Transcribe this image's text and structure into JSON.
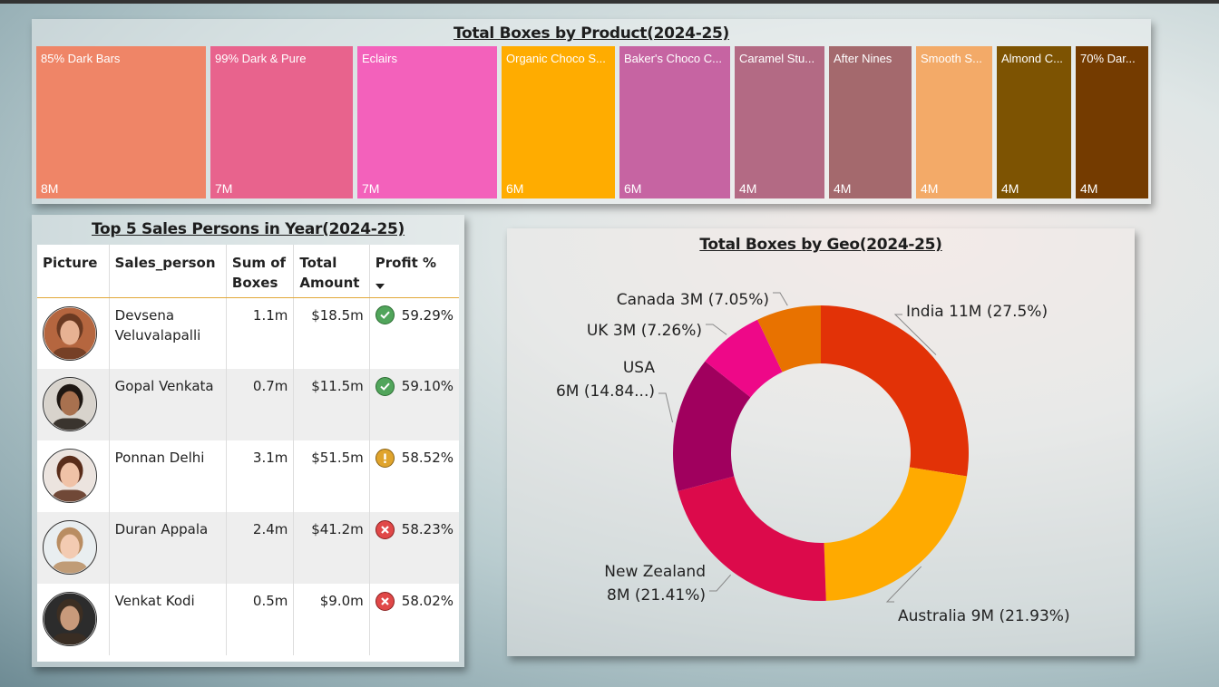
{
  "treemap": {
    "title": "Total Boxes by Product(2024-25)",
    "tiles": [
      {
        "label": "85% Dark Bars",
        "value": "8M",
        "color": "#ef8567"
      },
      {
        "label": "99% Dark & Pure",
        "value": "7M",
        "color": "#e8638d"
      },
      {
        "label": "Eclairs",
        "value": "7M",
        "color": "#f361bb"
      },
      {
        "label": "Organic Choco S...",
        "value": "6M",
        "color": "#ffac00"
      },
      {
        "label": "Baker's Choco C...",
        "value": "6M",
        "color": "#c664a2"
      },
      {
        "label": "Caramel Stu...",
        "value": "4M",
        "color": "#b36a84"
      },
      {
        "label": "After Nines",
        "value": "4M",
        "color": "#a4696d"
      },
      {
        "label": "Smooth S...",
        "value": "4M",
        "color": "#f3aa68"
      },
      {
        "label": "Almond C...",
        "value": "4M",
        "color": "#7d5302"
      },
      {
        "label": "70% Dar...",
        "value": "4M",
        "color": "#743b00"
      }
    ]
  },
  "table": {
    "title": "Top 5 Sales Persons in Year(2024-25)",
    "headers": {
      "picture": "Picture",
      "sales_person": "Sales_person",
      "boxes": "Sum of Boxes",
      "amount": "Total Amount",
      "profit": "Profit %"
    },
    "rows": [
      {
        "name": "Devsena Veluvalapalli",
        "boxes": "1.1m",
        "amount": "$18.5m",
        "profit": "59.29%",
        "status": "ok",
        "avatar_icon": "person-avatar-icon",
        "skin": "#e7b293",
        "hair": "#6b3a22",
        "bg": "#b5663f"
      },
      {
        "name": "Gopal Venkata",
        "boxes": "0.7m",
        "amount": "$11.5m",
        "profit": "59.10%",
        "status": "ok",
        "avatar_icon": "person-avatar-icon",
        "skin": "#a8714f",
        "hair": "#1e1712",
        "bg": "#d8d3cc"
      },
      {
        "name": "Ponnan Delhi",
        "boxes": "3.1m",
        "amount": "$51.5m",
        "profit": "58.52%",
        "status": "warn",
        "avatar_icon": "person-avatar-icon",
        "skin": "#f0c2a7",
        "hair": "#5a2d1a",
        "bg": "#ece4df"
      },
      {
        "name": "Duran Appala",
        "boxes": "2.4m",
        "amount": "$41.2m",
        "profit": "58.23%",
        "status": "bad",
        "avatar_icon": "person-avatar-icon",
        "skin": "#f3cbb2",
        "hair": "#b98d62",
        "bg": "#e9eef0"
      },
      {
        "name": "Venkat Kodi",
        "boxes": "0.5m",
        "amount": "$9.0m",
        "profit": "58.02%",
        "status": "bad",
        "avatar_icon": "person-avatar-icon",
        "skin": "#c89a7b",
        "hair": "#3c2e22",
        "bg": "#2c2c2c"
      }
    ]
  },
  "donut": {
    "title": "Total Boxes by Geo(2024-25)",
    "slices": [
      {
        "name": "India",
        "label_lines": [
          "India 11M (27.5%)"
        ],
        "percent": 27.5,
        "color": "#e23207"
      },
      {
        "name": "Australia",
        "label_lines": [
          "Australia 9M (21.93%)"
        ],
        "percent": 21.93,
        "color": "#ffaa00"
      },
      {
        "name": "New Zealand",
        "label_lines": [
          "New Zealand",
          "8M (21.41%)"
        ],
        "percent": 21.41,
        "color": "#dc0a4b"
      },
      {
        "name": "USA",
        "label_lines": [
          "USA",
          "6M (14.84...)"
        ],
        "percent": 14.84,
        "color": "#a0005e"
      },
      {
        "name": "UK",
        "label_lines": [
          "UK 3M (7.26%)"
        ],
        "percent": 7.26,
        "color": "#ee0888"
      },
      {
        "name": "Canada",
        "label_lines": [
          "Canada 3M (7.05%)"
        ],
        "percent": 7.05,
        "color": "#e87200"
      }
    ]
  }
}
